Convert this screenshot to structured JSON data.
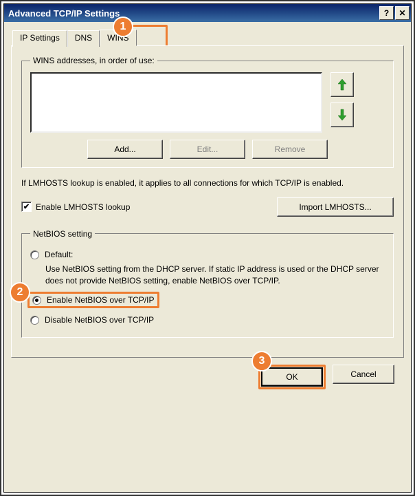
{
  "window": {
    "title": "Advanced TCP/IP Settings"
  },
  "tabs": {
    "ip_settings": "IP Settings",
    "dns": "DNS",
    "wins": "WINS"
  },
  "wins_group": {
    "legend": "WINS addresses, in order of use:",
    "buttons": {
      "add": "Add...",
      "edit": "Edit...",
      "remove": "Remove"
    }
  },
  "lmhosts": {
    "description": "If LMHOSTS lookup is enabled, it applies to all connections for which TCP/IP is enabled.",
    "checkbox_label": "Enable LMHOSTS lookup",
    "checkbox_checked": true,
    "import_button": "Import LMHOSTS..."
  },
  "netbios": {
    "legend": "NetBIOS setting",
    "options": {
      "default_label": "Default:",
      "default_desc": "Use NetBIOS setting from the DHCP server. If static IP address is used or the DHCP server does not provide NetBIOS setting, enable NetBIOS over TCP/IP.",
      "enable_label": "Enable NetBIOS over TCP/IP",
      "disable_label": "Disable NetBIOS over TCP/IP"
    },
    "selected": "enable"
  },
  "footer": {
    "ok": "OK",
    "cancel": "Cancel"
  },
  "callouts": {
    "c1": "1",
    "c2": "2",
    "c3": "3"
  },
  "icons": {
    "help": "?",
    "close": "✕",
    "checkmark": "✔"
  }
}
